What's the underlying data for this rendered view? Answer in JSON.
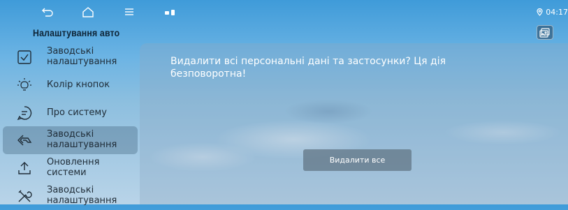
{
  "status": {
    "time": "04:17"
  },
  "header": {
    "title": "Налаштування авто"
  },
  "sidebar": {
    "items": [
      {
        "label": "Заводські налаштування",
        "icon": "checkbox-icon"
      },
      {
        "label": "Колір кнопок",
        "icon": "bulb-icon"
      },
      {
        "label": "Про систему",
        "icon": "chat-icon"
      },
      {
        "label": "Заводські налаштування",
        "icon": "back-arrow-icon",
        "active": true
      },
      {
        "label": "Оновлення системи",
        "icon": "upload-icon"
      },
      {
        "label": "Заводські налаштування",
        "icon": "tools-icon"
      }
    ]
  },
  "dialog": {
    "message": "Видалити всі персональні дані та застосунки? Ця дія безповоротна!",
    "button_label": "Видалити все"
  },
  "colors": {
    "sidebar_text": "#1f2c37",
    "title_text": "#0e2436"
  }
}
